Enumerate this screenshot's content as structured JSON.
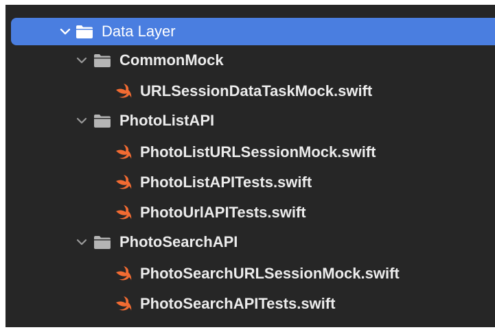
{
  "tree": {
    "root": {
      "label": "Data Layer",
      "expanded": true,
      "selected": true
    },
    "groups": [
      {
        "label": "CommonMock",
        "expanded": true,
        "files": [
          "URLSessionDataTaskMock.swift"
        ]
      },
      {
        "label": "PhotoListAPI",
        "expanded": true,
        "files": [
          "PhotoListURLSessionMock.swift",
          "PhotoListAPITests.swift",
          "PhotoUrlAPITests.swift"
        ]
      },
      {
        "label": "PhotoSearchAPI",
        "expanded": true,
        "files": [
          "PhotoSearchURLSessionMock.swift",
          "PhotoSearchAPITests.swift"
        ]
      }
    ]
  },
  "icons": {
    "disclosure": "chevron-down-icon",
    "folder": "folder-icon",
    "swift_file": "swift-file-icon"
  },
  "colors": {
    "background": "#262626",
    "selection": "#4a7ee0",
    "text": "#ececec",
    "swift_orange": "#f26b32",
    "group_folder": "#b5b5b5"
  }
}
